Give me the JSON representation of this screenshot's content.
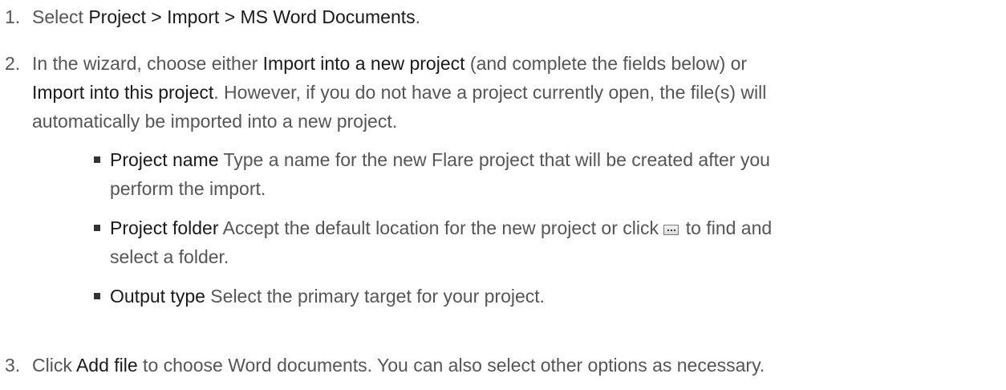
{
  "steps": [
    {
      "number": "1.",
      "parts": [
        "Select ",
        "Project > Import > MS Word Documents",
        "."
      ]
    },
    {
      "number": "2.",
      "line1": [
        "In the wizard, choose either ",
        "Import into a new project",
        " (and complete the fields below) or"
      ],
      "line2": [
        "Import into this project",
        ". However, if you do not have a project currently open, the file(s) will"
      ],
      "line3": "automatically be imported into a new project.",
      "subitems": [
        {
          "term": "Project name",
          "line1": " Type a name for the new Flare project that will be created after you",
          "line2": "perform the import."
        },
        {
          "term": "Project folder",
          "line1a": " Accept the default location for the new project or click ",
          "button_icon": "ellipsis-browse-button-icon",
          "line1b": " to find and",
          "line2": "select a folder."
        },
        {
          "term": "Output type",
          "line1": " Select the primary target for your project."
        }
      ]
    },
    {
      "number": "3.",
      "parts": [
        "Click ",
        "Add file",
        " to choose Word documents. You can also select other options as necessary."
      ]
    }
  ]
}
